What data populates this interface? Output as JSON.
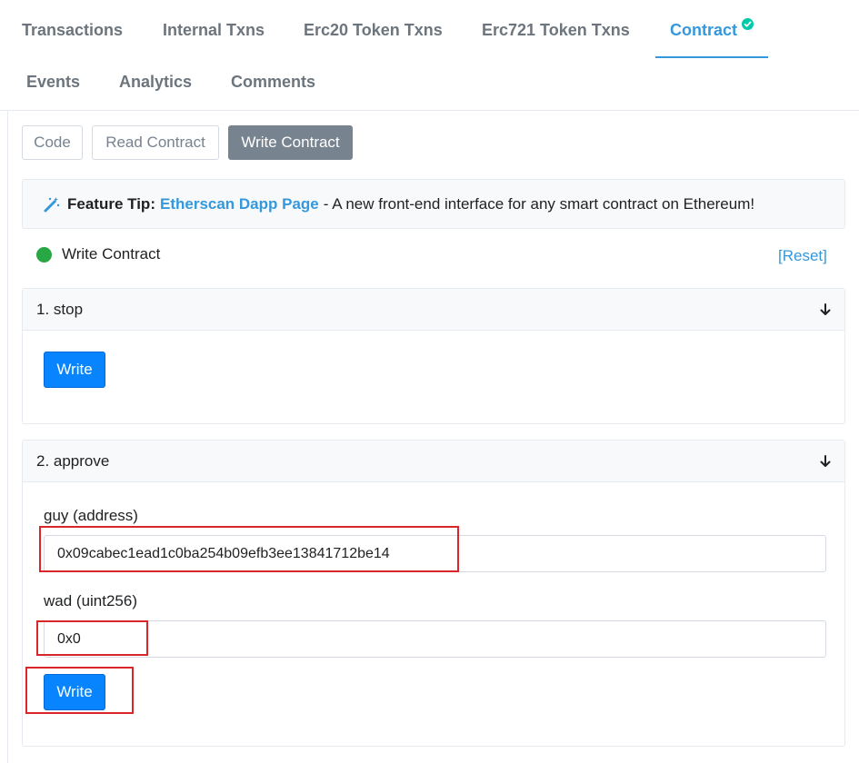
{
  "tabs": [
    {
      "label": "Transactions"
    },
    {
      "label": "Internal Txns"
    },
    {
      "label": "Erc20 Token Txns"
    },
    {
      "label": "Erc721 Token Txns"
    },
    {
      "label": "Contract"
    },
    {
      "label": "Events"
    },
    {
      "label": "Analytics"
    },
    {
      "label": "Comments"
    }
  ],
  "active_tab": "Contract",
  "subtabs": [
    {
      "label": "Code"
    },
    {
      "label": "Read Contract"
    },
    {
      "label": "Write Contract"
    }
  ],
  "active_subtab": "Write Contract",
  "tip": {
    "label": "Feature Tip:",
    "link": "Etherscan Dapp Page",
    "text": "- A new front-end interface for any smart contract on Ethereum!"
  },
  "status": {
    "text": "Write Contract",
    "reset": "[Reset]"
  },
  "colors": {
    "accent": "#3498db",
    "connected": "#28a745",
    "write_button": "#0784fe",
    "highlight": "#d9262a"
  },
  "functions": [
    {
      "title": "1. stop",
      "button": "Write"
    },
    {
      "title": "2. approve",
      "button": "Write",
      "inputs": [
        {
          "label": "guy (address)",
          "value": "0x09cabec1ead1c0ba254b09efb3ee13841712be14"
        },
        {
          "label": "wad (uint256)",
          "value": "0x0"
        }
      ]
    }
  ]
}
